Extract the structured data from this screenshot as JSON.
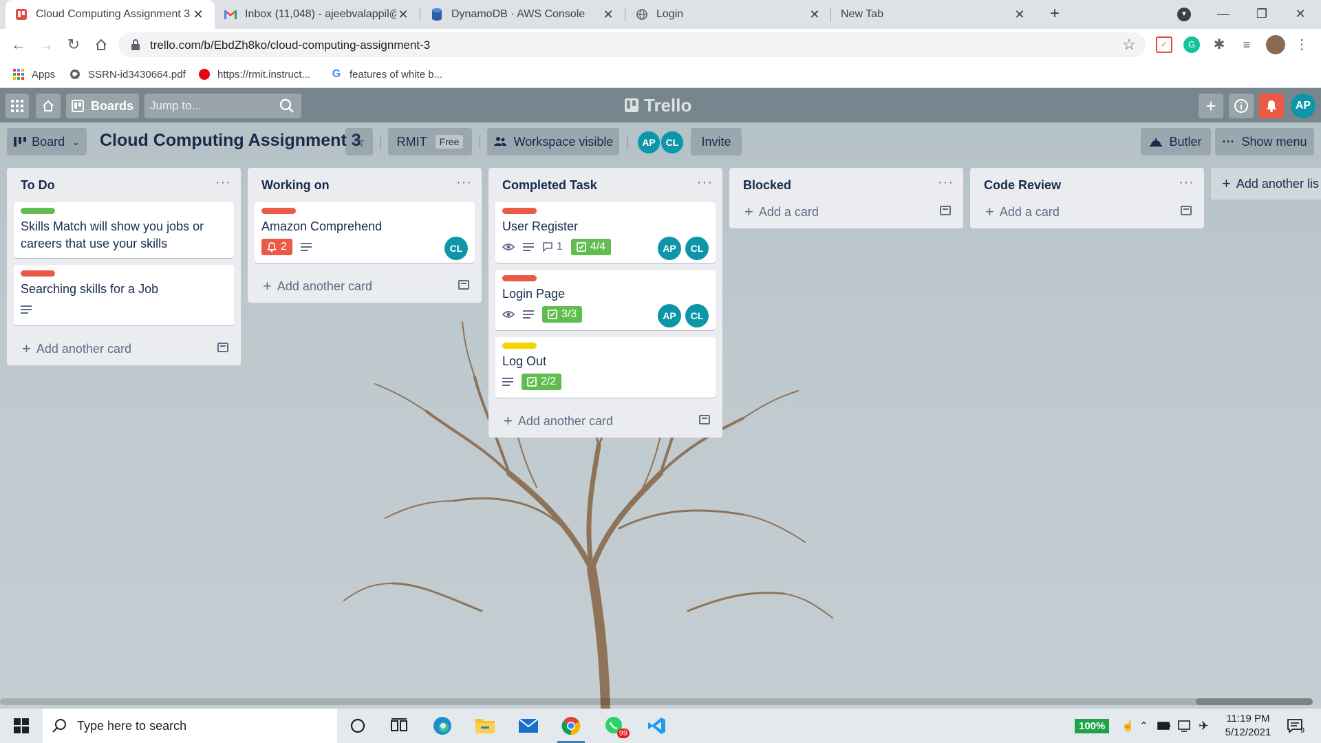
{
  "browser": {
    "tabs": [
      {
        "title": "Cloud Computing Assignment 3 |",
        "favicon": "trello-icon",
        "active": true
      },
      {
        "title": "Inbox (11,048) - ajeebvalappil@g",
        "favicon": "gmail-icon",
        "active": false
      },
      {
        "title": "DynamoDB · AWS Console",
        "favicon": "dynamodb-icon",
        "active": false
      },
      {
        "title": "Login",
        "favicon": "globe-icon",
        "active": false
      },
      {
        "title": "New Tab",
        "favicon": "none",
        "active": false
      }
    ],
    "url": "trello.com/b/EbdZh8ko/cloud-computing-assignment-3",
    "bookmarks": [
      {
        "label": "Apps",
        "icon": "apps-grid-icon"
      },
      {
        "label": "SSRN-id3430664.pdf",
        "icon": "globe-icon"
      },
      {
        "label": "https://rmit.instruct...",
        "icon": "canvas-icon"
      },
      {
        "label": "features of white b...",
        "icon": "google-icon"
      }
    ]
  },
  "trello": {
    "header": {
      "boards_label": "Boards",
      "search_placeholder": "Jump to...",
      "logo_text": "Trello",
      "user_initials": "AP"
    },
    "boardbar": {
      "view_label": "Board",
      "title": "Cloud Computing Assignment 3",
      "workspace": "RMIT",
      "plan": "Free",
      "visibility": "Workspace visible",
      "members": [
        "AP",
        "CL"
      ],
      "invite_label": "Invite",
      "butler_label": "Butler",
      "show_menu_label": "Show menu"
    },
    "lists": [
      {
        "title": "To Do",
        "add_label": "Add another card",
        "cards": [
          {
            "title": "Skills Match will show you jobs or careers that use your skills",
            "label_color": "#61bd4f"
          },
          {
            "title": "Searching skills for a Job",
            "label_color": "#eb5a46"
          }
        ]
      },
      {
        "title": "Working on",
        "add_label": "Add another card",
        "cards": [
          {
            "title": "Amazon Comprehend",
            "label_color": "#eb5a46",
            "due_count": "2",
            "members": [
              "CL"
            ]
          }
        ]
      },
      {
        "title": "Completed Task",
        "add_label": "Add another card",
        "cards": [
          {
            "title": "User Register",
            "label_color": "#eb5a46",
            "comments": "1",
            "checklist": "4/4",
            "members": [
              "AP",
              "CL"
            ]
          },
          {
            "title": "Login Page",
            "label_color": "#eb5a46",
            "checklist": "3/3",
            "members": [
              "AP",
              "CL"
            ]
          },
          {
            "title": "Log Out",
            "label_color": "#f2d600",
            "checklist": "2/2"
          }
        ]
      },
      {
        "title": "Blocked",
        "add_label": "Add a card",
        "cards": []
      },
      {
        "title": "Code Review",
        "add_label": "Add a card",
        "cards": []
      }
    ],
    "add_list_label": "Add another lis"
  },
  "taskbar": {
    "search_placeholder": "Type here to search",
    "zoom": "100%",
    "mail_badge": "99",
    "notif_count": "9",
    "time": "11:19 PM",
    "date": "5/12/2021"
  },
  "colors": {
    "trello_green": "#61bd4f",
    "trello_red": "#eb5a46",
    "trello_yellow": "#f2d600",
    "avatar_teal": "#0d96a8",
    "notification_red": "#eb5a46"
  }
}
